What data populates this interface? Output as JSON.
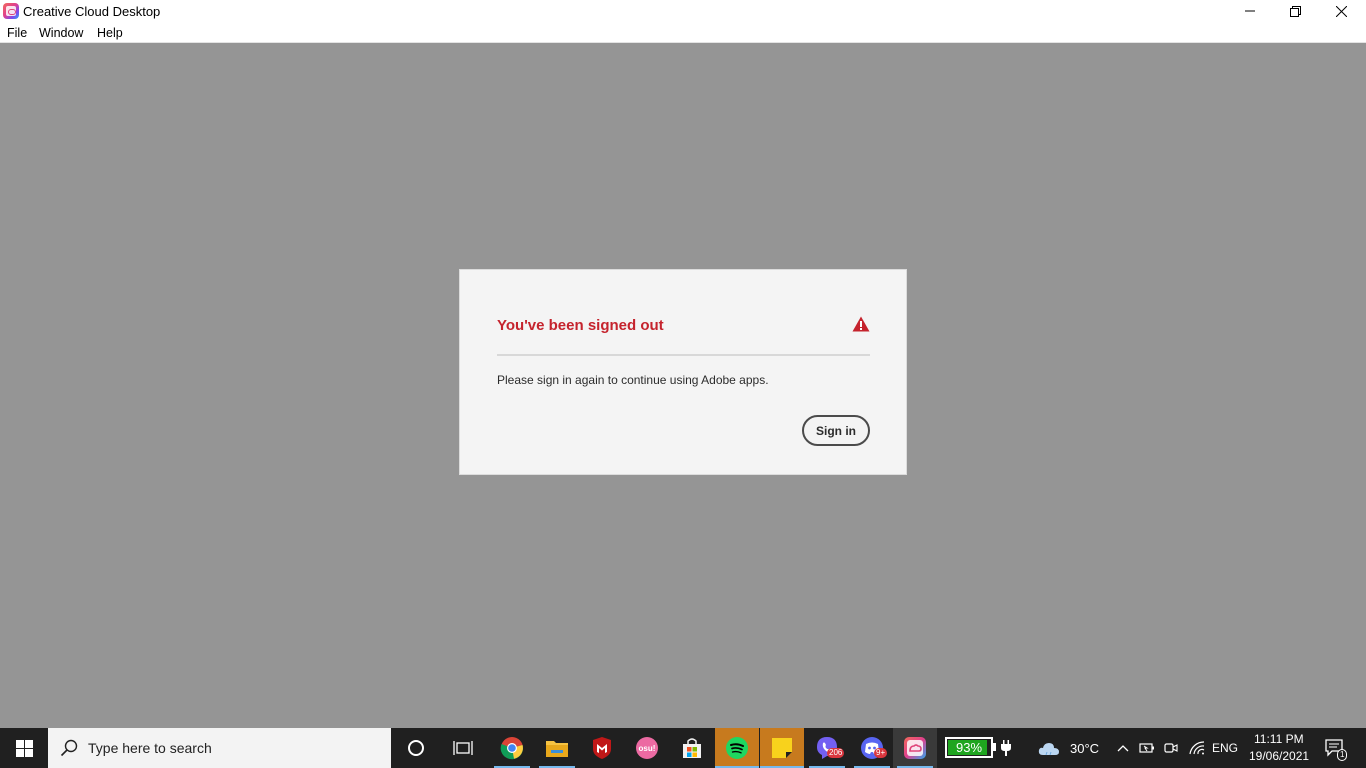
{
  "window": {
    "title": "Creative Cloud Desktop"
  },
  "menu": {
    "items": [
      "File",
      "Window",
      "Help"
    ]
  },
  "dialog": {
    "title": "You've been signed out",
    "message": "Please sign in again to continue using Adobe apps.",
    "signin_label": "Sign in",
    "title_color": "#c5232d",
    "icon": "warning-icon"
  },
  "taskbar": {
    "search_placeholder": "Type here to search",
    "apps": [
      {
        "name": "cortana",
        "icon": "cortana-icon"
      },
      {
        "name": "task-view",
        "icon": "task-view-icon"
      },
      {
        "name": "chrome",
        "icon": "chrome-icon"
      },
      {
        "name": "file-explorer",
        "icon": "folder-icon"
      },
      {
        "name": "mcafee",
        "icon": "mcafee-icon"
      },
      {
        "name": "osu",
        "icon": "osu-icon",
        "label": "osu!"
      },
      {
        "name": "microsoft-store",
        "icon": "store-icon"
      },
      {
        "name": "spotify",
        "icon": "spotify-icon"
      },
      {
        "name": "sticky-notes",
        "icon": "sticky-notes-icon"
      },
      {
        "name": "viber",
        "icon": "viber-icon",
        "badge": "206"
      },
      {
        "name": "discord",
        "icon": "discord-icon",
        "badge": "9+"
      },
      {
        "name": "creative-cloud",
        "icon": "creative-cloud-icon"
      }
    ],
    "battery": {
      "label": "93%",
      "level": 0.93
    },
    "weather": {
      "temp": "30°C",
      "icon": "cloud-icon"
    },
    "language": "ENG",
    "time": "11:11 PM",
    "date": "19/06/2021",
    "notification_count": "1"
  }
}
